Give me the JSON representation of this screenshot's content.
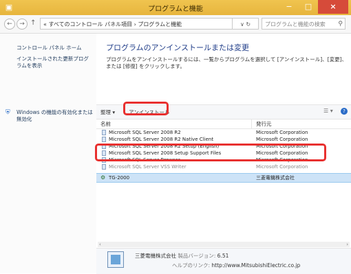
{
  "window": {
    "title": "プログラムと機能",
    "buttons": {
      "minimize": "−",
      "maximize": "□",
      "close": "×"
    }
  },
  "address_bar": {
    "path": "« すべてのコントロール パネル項目 › プログラムと機能",
    "refresh": "∨ ↻",
    "search_placeholder": "プログラムと機能の検索"
  },
  "sidebar": {
    "items": [
      {
        "label": "コントロール パネル ホーム"
      },
      {
        "label": "インストールされた更新プログラムを表示"
      },
      {
        "label": "Windows の機能の有効化または無効化"
      }
    ]
  },
  "main": {
    "heading": "プログラムのアンインストールまたは変更",
    "description": "プログラムをアンインストールするには、一覧からプログラムを選択して [アンインストール]、[変更]、または [修復] をクリックします。"
  },
  "toolbar": {
    "organize": "整理 ▾",
    "uninstall": "アンインストール"
  },
  "columns": {
    "name": "名前",
    "publisher": "発行元"
  },
  "programs": [
    {
      "name": "Microsoft SQL Server 2008 R2",
      "publisher": "Microsoft Corporation"
    },
    {
      "name": "Microsoft SQL Server 2008 R2 Native Client",
      "publisher": "Microsoft Corporation"
    },
    {
      "name": "Microsoft SQL Server 2008 R2 Setup (English)",
      "publisher": "Microsoft Corporation"
    },
    {
      "name": "Microsoft SQL Server 2008 Setup Support Files",
      "publisher": "Microsoft Corporation"
    },
    {
      "name": "Microsoft SQL Server Browser",
      "publisher": "Microsoft Corporation"
    },
    {
      "name": "Microsoft SQL Server VSS Writer",
      "publisher": "Microsoft Corporation"
    }
  ],
  "selected_program": {
    "name": "TG-2000",
    "publisher": "三菱電機株式会社"
  },
  "details": {
    "publisher": "三菱電機株式会社",
    "version_label": "製品バージョン:",
    "version": "6.51",
    "help_label": "ヘルプのリンク:",
    "help_link": "http://www.MitsubishiElectric.co.jp"
  },
  "colors": {
    "titlebar": "#e9b845",
    "selection": "#cde3f7",
    "callout": "#e8302f",
    "link": "#1e395b"
  }
}
